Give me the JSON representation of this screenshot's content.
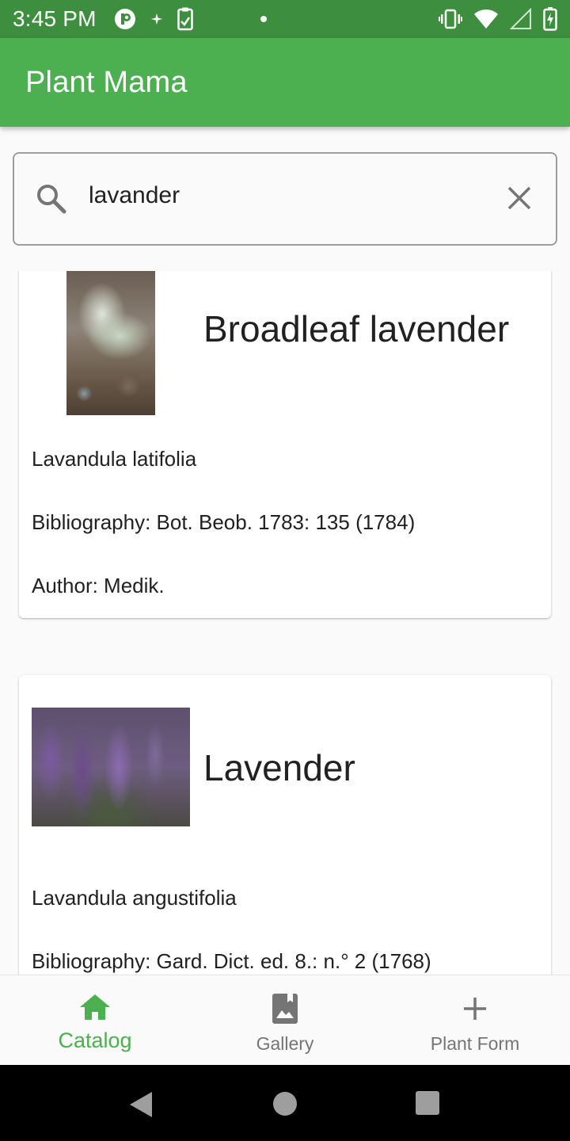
{
  "status_bar": {
    "time": "3:45 PM",
    "left_icons": [
      "p-badge-icon",
      "sparkle-icon",
      "clipboard-icon",
      "dot-icon"
    ],
    "right_icons": [
      "vibrate-icon",
      "wifi-icon",
      "signal-icon",
      "battery-charging-icon"
    ]
  },
  "app_bar": {
    "title": "Plant Mama"
  },
  "search": {
    "value": "lavander",
    "icon": "search-icon",
    "clear_icon": "close-icon"
  },
  "plants": [
    {
      "common_name": "Broadleaf lavender",
      "scientific_name": "Lavandula latifolia",
      "bibliography": "Bibliography: Bot. Beob. 1783: 135 (1784)",
      "author": "Author: Medik."
    },
    {
      "common_name": "Lavender",
      "scientific_name": "Lavandula angustifolia",
      "bibliography": "Bibliography: Gard. Dict. ed. 8.: n.° 2 (1768)"
    }
  ],
  "bottom_nav": {
    "items": [
      {
        "label": "Catalog",
        "icon": "home-icon",
        "active": true
      },
      {
        "label": "Gallery",
        "icon": "photo-album-icon",
        "active": false
      },
      {
        "label": "Plant Form",
        "icon": "plus-icon",
        "active": false
      }
    ]
  },
  "colors": {
    "primary": "#4caf50",
    "status_bar": "#3d8f3f",
    "inactive_nav": "#757575"
  }
}
